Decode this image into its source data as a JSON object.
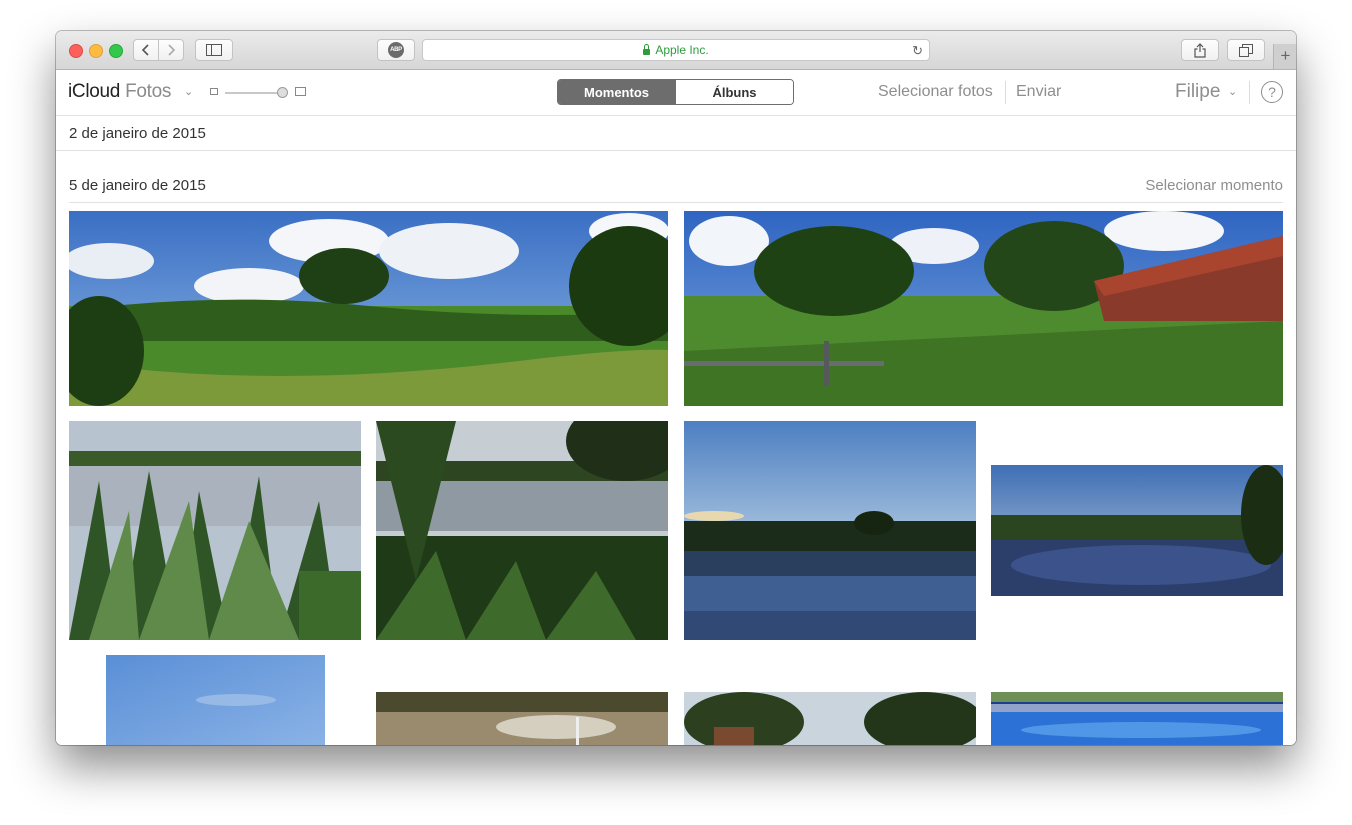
{
  "browser": {
    "url_text": "Apple Inc.",
    "adblock_badge": "ABP",
    "new_tab_label": "+"
  },
  "header": {
    "brand": "iCloud",
    "app_name": "Fotos",
    "tabs": [
      {
        "label": "Momentos",
        "active": true
      },
      {
        "label": "Álbuns",
        "active": false
      }
    ],
    "select_photos": "Selecionar fotos",
    "upload": "Enviar",
    "user_name": "Filipe",
    "help_label": "?"
  },
  "moments": [
    {
      "date": "2 de janeiro de 2015"
    },
    {
      "date": "5 de janeiro de 2015",
      "select_label": "Selecionar momento"
    }
  ],
  "colors": {
    "accent_secure": "#2d9c3c",
    "segment_active": "#6d6d6d",
    "muted_text": "#8e8e8e"
  },
  "photos": [
    {
      "subject": "panorama-field"
    },
    {
      "subject": "panorama-farmhouse"
    },
    {
      "subject": "lake-plants"
    },
    {
      "subject": "lake-reeds"
    },
    {
      "subject": "lake-dusk"
    },
    {
      "subject": "lake-wide"
    },
    {
      "subject": "sky"
    },
    {
      "subject": "lake-reflection"
    },
    {
      "subject": "farm-trees"
    },
    {
      "subject": "pool"
    }
  ]
}
